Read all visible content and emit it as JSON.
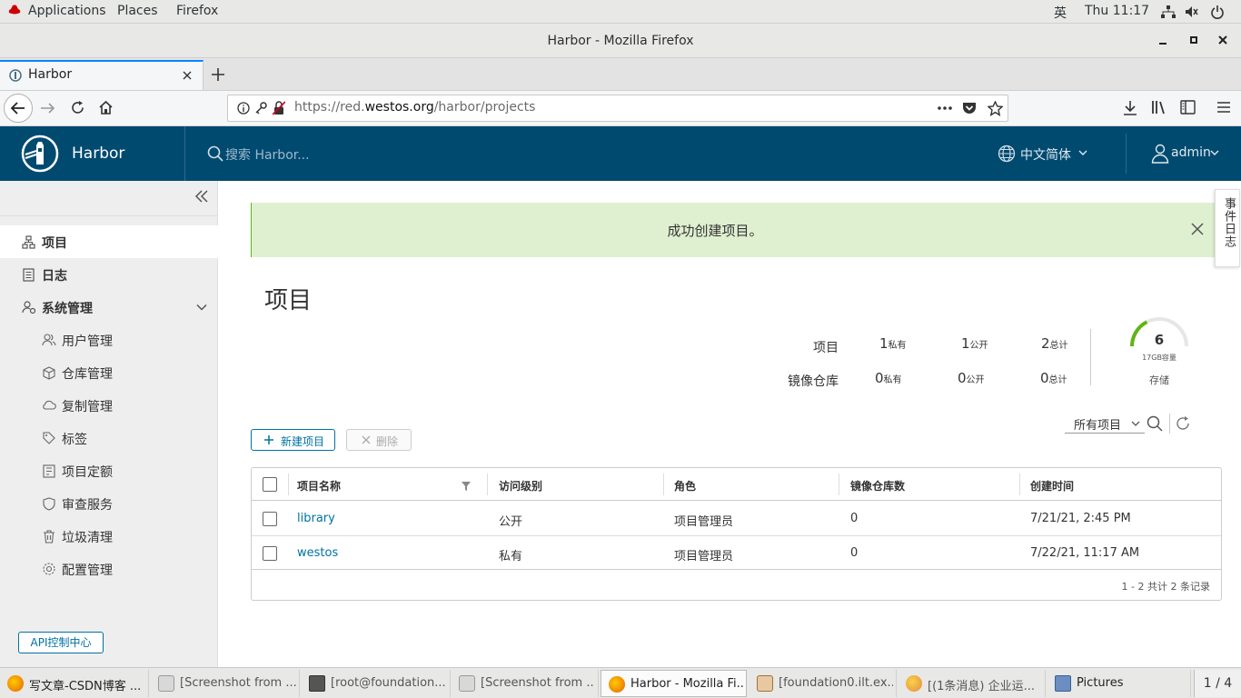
{
  "gnome": {
    "applications": "Applications",
    "places": "Places",
    "firefox": "Firefox",
    "ime": "英",
    "clock": "Thu 11:17"
  },
  "window": {
    "title": "Harbor - Mozilla Firefox"
  },
  "tab": {
    "label": "Harbor"
  },
  "url": {
    "prefix": "https://red.",
    "domain": "westos.org",
    "path": "/harbor/projects"
  },
  "harbor": {
    "brand": "Harbor",
    "search_placeholder": "搜索 Harbor...",
    "language": "中文简体",
    "user": "admin"
  },
  "sidebar": {
    "items": [
      {
        "label": "项目"
      },
      {
        "label": "日志"
      },
      {
        "label": "系统管理"
      },
      {
        "label": "用户管理"
      },
      {
        "label": "仓库管理"
      },
      {
        "label": "复制管理"
      },
      {
        "label": "标签"
      },
      {
        "label": "项目定额"
      },
      {
        "label": "审查服务"
      },
      {
        "label": "垃圾清理"
      },
      {
        "label": "配置管理"
      }
    ],
    "api_button": "API控制中心"
  },
  "alert": {
    "message": "成功创建项目。"
  },
  "event_log": "事件日志",
  "page_title": "项目",
  "stats": {
    "projects_label": "项目",
    "repos_label": "镜像仓库",
    "projects": {
      "private": "1",
      "public": "1",
      "total": "2"
    },
    "repos": {
      "private": "0",
      "public": "0",
      "total": "0"
    },
    "private_label": "私有",
    "public_label": "公开",
    "total_label": "总计",
    "storage_value": "6",
    "storage_capacity": "17GB容量",
    "storage_label": "存储",
    "storage_fraction": 0.35
  },
  "toolbar": {
    "new_project": "新建项目",
    "delete": "删除",
    "filter": "所有项目"
  },
  "table": {
    "headers": [
      "项目名称",
      "访问级别",
      "角色",
      "镜像仓库数",
      "创建时间"
    ],
    "rows": [
      {
        "name": "library",
        "access": "公开",
        "role": "项目管理员",
        "repos": "0",
        "created": "7/21/21, 2:45 PM"
      },
      {
        "name": "westos",
        "access": "私有",
        "role": "项目管理员",
        "repos": "0",
        "created": "7/22/21, 11:17 AM"
      }
    ],
    "footer": "1 - 2 共计 2 条记录"
  },
  "taskbar": {
    "items": [
      {
        "label": "写文章-CSDN博客 ..."
      },
      {
        "label": "[Screenshot from ..."
      },
      {
        "label": "[root@foundation..."
      },
      {
        "label": "[Screenshot from ..."
      },
      {
        "label": "Harbor - Mozilla Fi..."
      },
      {
        "label": "[foundation0.ilt.ex..."
      },
      {
        "label": "[(1条消息) 企业运..."
      },
      {
        "label": "Pictures"
      }
    ],
    "workspace": "1 / 4"
  },
  "colors": {
    "header": "#004a70",
    "link": "#0072a3",
    "success_bg": "#dff0d0",
    "gauge": "#60b515"
  }
}
